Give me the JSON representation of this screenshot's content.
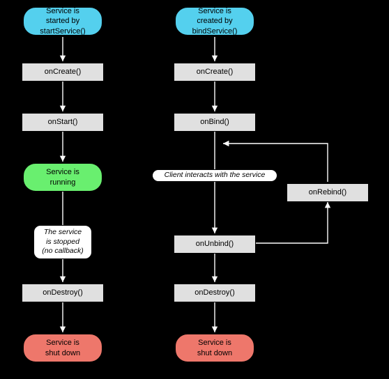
{
  "chart_data": {
    "type": "flowchart",
    "columns": [
      {
        "start": "Service is started by startService()",
        "steps": [
          "onCreate()",
          "onStart()"
        ],
        "run_state": "Service is running",
        "annotation": "The service is stopped (no callback)",
        "destroy": "onDestroy()",
        "end": "Service is shut down"
      },
      {
        "start": "Service is created by bindService()",
        "steps": [
          "onCreate()",
          "onBind()"
        ],
        "annotation": "Client interacts with the service",
        "rebind": "onRebind()",
        "unbind": "onUnbind()",
        "destroy": "onDestroy()",
        "end": "Service is shut down"
      }
    ]
  },
  "colors": {
    "start": "#54d0ee",
    "running": "#69ef6f",
    "end": "#ee776b",
    "box": "#e0e0e0"
  },
  "left": {
    "start_l1": "Service is",
    "start_l2": "started by",
    "start_l3": "startService()",
    "on_create": "onCreate()",
    "on_start": "onStart()",
    "running_l1": "Service is",
    "running_l2": "running",
    "annot_l1": "The service",
    "annot_l2": "is stopped",
    "annot_l3": "(no callback)",
    "on_destroy": "onDestroy()",
    "shut_l1": "Service is",
    "shut_l2": "shut down"
  },
  "right": {
    "start_l1": "Service is",
    "start_l2": "created by",
    "start_l3": "bindService()",
    "on_create": "onCreate()",
    "on_bind": "onBind()",
    "annot": "Client interacts with the service",
    "on_rebind": "onRebind()",
    "on_unbind": "onUnbind()",
    "on_destroy": "onDestroy()",
    "shut_l1": "Service is",
    "shut_l2": "shut down"
  }
}
